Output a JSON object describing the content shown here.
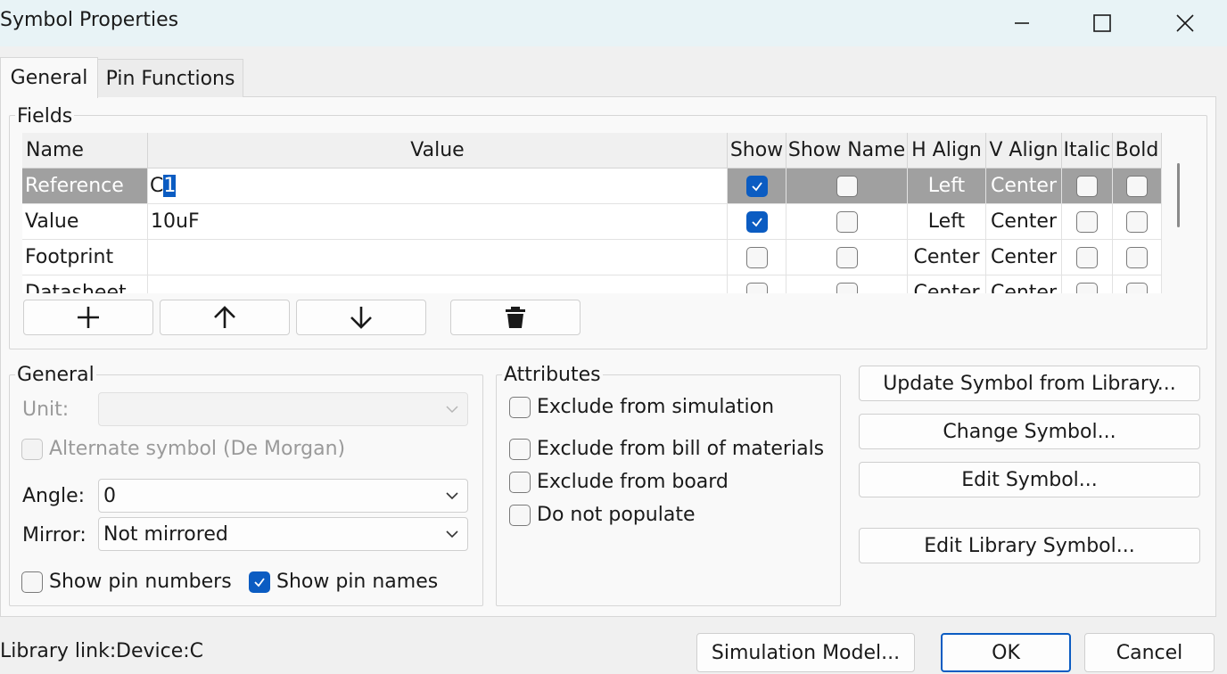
{
  "window": {
    "title": "Symbol Properties"
  },
  "tabs": [
    {
      "label": "General"
    },
    {
      "label": "Pin Functions"
    }
  ],
  "fields": {
    "group_label": "Fields",
    "columns": [
      "Name",
      "Value",
      "Show",
      "Show Name",
      "H Align",
      "V Align",
      "Italic",
      "Bold"
    ],
    "rows": [
      {
        "name": "Reference",
        "value_prefix": "C",
        "value_selected": "1",
        "show": true,
        "show_name": false,
        "h_align": "Left",
        "v_align": "Center",
        "italic": false,
        "bold": false
      },
      {
        "name": "Value",
        "value": "10uF",
        "show": true,
        "show_name": false,
        "h_align": "Left",
        "v_align": "Center",
        "italic": false,
        "bold": false
      },
      {
        "name": "Footprint",
        "value": "",
        "show": false,
        "show_name": false,
        "h_align": "Center",
        "v_align": "Center",
        "italic": false,
        "bold": false
      },
      {
        "name": "Datasheet",
        "value": "",
        "show": false,
        "show_name": false,
        "h_align": "Center",
        "v_align": "Center",
        "italic": false,
        "bold": false
      }
    ],
    "toolbar_icons": [
      "add-icon",
      "arrow-up-icon",
      "arrow-down-icon",
      "trash-icon"
    ]
  },
  "general": {
    "group_label": "General",
    "unit_label": "Unit:",
    "unit_value": "",
    "alternate_label": "Alternate symbol (De Morgan)",
    "angle_label": "Angle:",
    "angle_value": "0",
    "mirror_label": "Mirror:",
    "mirror_value": "Not mirrored",
    "show_pin_numbers": {
      "label": "Show pin numbers",
      "checked": false
    },
    "show_pin_names": {
      "label": "Show pin names",
      "checked": true
    }
  },
  "attributes": {
    "group_label": "Attributes",
    "items": [
      {
        "label": "Exclude from simulation",
        "checked": false
      },
      {
        "label": "Exclude from bill of materials",
        "checked": false
      },
      {
        "label": "Exclude from board",
        "checked": false
      },
      {
        "label": "Do not populate",
        "checked": false
      }
    ]
  },
  "actions": {
    "update_symbol": "Update Symbol from Library...",
    "change_symbol": "Change Symbol...",
    "edit_symbol": "Edit Symbol...",
    "edit_library_symbol": "Edit Library Symbol..."
  },
  "footer": {
    "library_link_label": "Library link:",
    "library_link_value": "Device:C",
    "simulation_model": "Simulation Model...",
    "ok": "OK",
    "cancel": "Cancel"
  },
  "colors": {
    "accent": "#0b5cc2",
    "selected_row": "#a0a0a0",
    "titlebar": "#e8f3f6"
  }
}
